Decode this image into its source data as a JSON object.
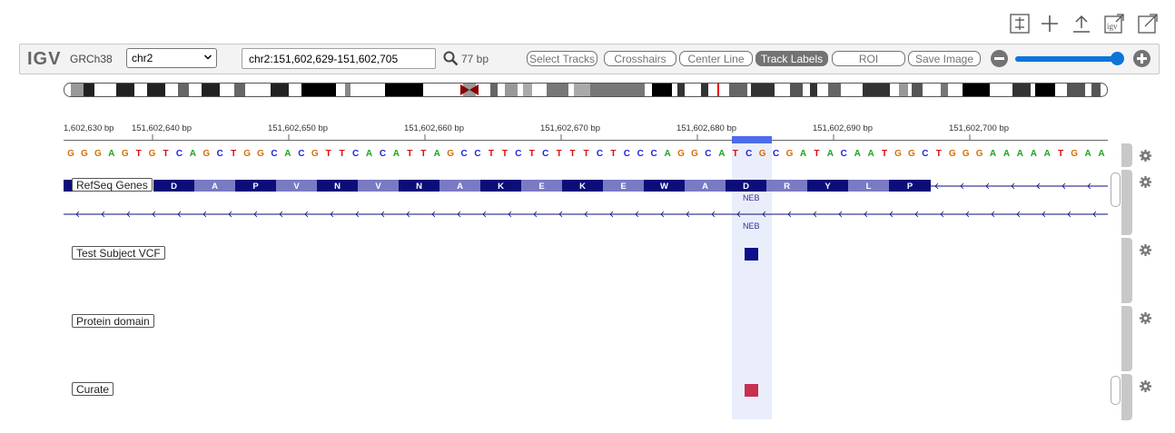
{
  "top_icons": [
    "sliders-icon",
    "plus-icon",
    "upload-icon",
    "igv-export-icon",
    "external-window-icon"
  ],
  "navbar": {
    "logo": "IGV",
    "genome": "GRCh38",
    "chromosome": "chr2",
    "locus": "chr2:151,602,629-151,602,705",
    "bp_width": "77 bp",
    "buttons": {
      "select_tracks": "Select Tracks",
      "crosshairs": "Crosshairs",
      "center_line": "Center Line",
      "track_labels": "Track Labels",
      "roi": "ROI",
      "save_image": "Save Image"
    },
    "zoom_level": 0.95
  },
  "ruler": {
    "ticks": [
      "1,602,630 bp",
      "151,602,640 bp",
      "151,602,650 bp",
      "151,602,660 bp",
      "151,602,670 bp",
      "151,602,680 bp",
      "151,602,690 bp",
      "151,602,700 bp"
    ]
  },
  "sequence": "GGGAGTGTCAGCTGGCACGTTCACATTAGCCTTCTCTTTCTCCCAGGCATCGCGATACAATGGCTGGGAAAAATGAA",
  "base_colors": {
    "A": "#1aa51a",
    "C": "#2222d8",
    "G": "#d17105",
    "T": "#d80f0f"
  },
  "tracks": {
    "refseq": {
      "label": "RefSeq Genes",
      "amino_acids": [
        "D",
        "A",
        "P",
        "V",
        "N",
        "V",
        "N",
        "A",
        "K",
        "E",
        "K",
        "E",
        "W",
        "A",
        "D",
        "R",
        "Y",
        "L",
        "P"
      ],
      "gene_name_1": "NEB",
      "gene_name_2": "NEB",
      "colors": {
        "dark": "#0d0d7a",
        "light": "#7a7ac4"
      }
    },
    "vcf": {
      "label": "Test Subject VCF",
      "color": "#0f0f8c"
    },
    "protein": {
      "label": "Protein domain"
    },
    "curate": {
      "label": "Curate",
      "color": "#c8304f"
    }
  }
}
